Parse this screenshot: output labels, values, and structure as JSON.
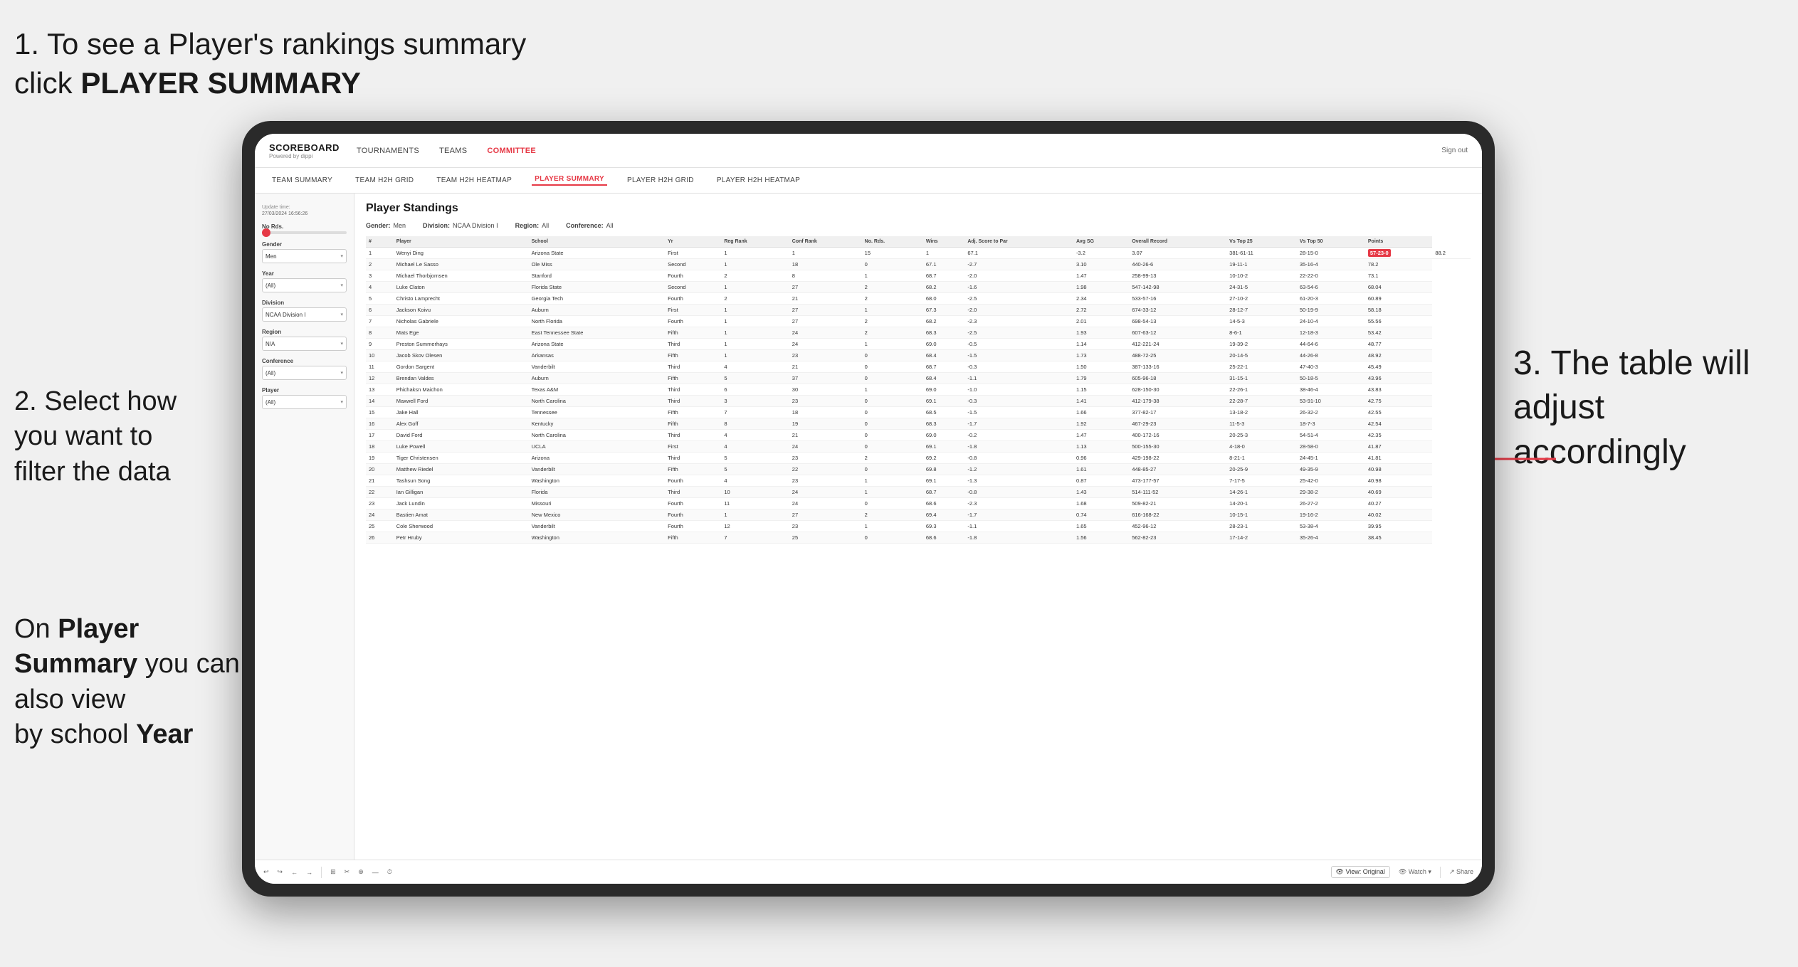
{
  "annotations": {
    "text1": "1. To see a Player's rankings summary click ",
    "text1_bold": "PLAYER SUMMARY",
    "text2_line1": "2. Select how",
    "text2_line2": "you want to",
    "text2_line3": "filter the data",
    "text3_line1": "3. The table will",
    "text3_line2": "adjust accordingly",
    "text4_line1": "On ",
    "text4_bold1": "Player",
    "text4_line2": "Summary",
    "text4_normal": " you can also view by school ",
    "text4_bold2": "Year"
  },
  "navbar": {
    "logo": "SCOREBOARD",
    "logo_sub": "Powered by dippi",
    "nav_items": [
      "TOURNAMENTS",
      "TEAMS",
      "COMMITTEE"
    ],
    "nav_right": [
      "Sign out"
    ],
    "subnav_items": [
      "TEAM SUMMARY",
      "TEAM H2H GRID",
      "TEAM H2H HEATMAP",
      "PLAYER SUMMARY",
      "PLAYER H2H GRID",
      "PLAYER H2H HEATMAP"
    ]
  },
  "sidebar": {
    "update_label": "Update time:",
    "update_time": "27/03/2024 16:56:26",
    "no_rds_label": "No Rds.",
    "slider_val": "0",
    "gender_label": "Gender",
    "gender_val": "Men",
    "year_label": "Year",
    "year_val": "(All)",
    "division_label": "Division",
    "division_val": "NCAA Division I",
    "region_label": "Region",
    "region_val": "N/A",
    "conference_label": "Conference",
    "conference_val": "(All)",
    "player_label": "Player",
    "player_val": "(All)"
  },
  "table": {
    "title": "Player Standings",
    "gender_label": "Gender:",
    "gender_val": "Men",
    "division_label": "Division:",
    "division_val": "NCAA Division I",
    "region_label": "Region:",
    "region_val": "All",
    "conference_label": "Conference:",
    "conference_val": "All",
    "columns": [
      "#",
      "Player",
      "School",
      "Yr",
      "Reg Rank",
      "Conf Rank",
      "No. Rds.",
      "Wins",
      "Adj. Score to Par",
      "Avg SG",
      "Overall Record",
      "Vs Top 25",
      "Vs Top 50",
      "Points"
    ],
    "rows": [
      [
        "1",
        "Wenyi Ding",
        "Arizona State",
        "First",
        "1",
        "1",
        "15",
        "1",
        "67.1",
        "-3.2",
        "3.07",
        "381-61-11",
        "28-15-0",
        "57-23-0",
        "88.2"
      ],
      [
        "2",
        "Michael Le Sasso",
        "Ole Miss",
        "Second",
        "1",
        "18",
        "0",
        "67.1",
        "-2.7",
        "3.10",
        "440-26-6",
        "19-11-1",
        "35-16-4",
        "78.2"
      ],
      [
        "3",
        "Michael Thorbjornsen",
        "Stanford",
        "Fourth",
        "2",
        "8",
        "1",
        "68.7",
        "-2.0",
        "1.47",
        "258-99-13",
        "10-10-2",
        "22-22-0",
        "73.1"
      ],
      [
        "4",
        "Luke Claton",
        "Florida State",
        "Second",
        "1",
        "27",
        "2",
        "68.2",
        "-1.6",
        "1.98",
        "547-142-98",
        "24-31-5",
        "63-54-6",
        "68.04"
      ],
      [
        "5",
        "Christo Lamprecht",
        "Georgia Tech",
        "Fourth",
        "2",
        "21",
        "2",
        "68.0",
        "-2.5",
        "2.34",
        "533-57-16",
        "27-10-2",
        "61-20-3",
        "60.89"
      ],
      [
        "6",
        "Jackson Koivu",
        "Auburn",
        "First",
        "1",
        "27",
        "1",
        "67.3",
        "-2.0",
        "2.72",
        "674-33-12",
        "28-12-7",
        "50-19-9",
        "58.18"
      ],
      [
        "7",
        "Nicholas Gabriele",
        "North Florida",
        "Fourth",
        "1",
        "27",
        "2",
        "68.2",
        "-2.3",
        "2.01",
        "698-54-13",
        "14-5-3",
        "24-10-4",
        "55.56"
      ],
      [
        "8",
        "Mats Ege",
        "East Tennessee State",
        "Fifth",
        "1",
        "24",
        "2",
        "68.3",
        "-2.5",
        "1.93",
        "607-63-12",
        "8-6-1",
        "12-18-3",
        "53.42"
      ],
      [
        "9",
        "Preston Summerhays",
        "Arizona State",
        "Third",
        "1",
        "24",
        "1",
        "69.0",
        "-0.5",
        "1.14",
        "412-221-24",
        "19-39-2",
        "44-64-6",
        "48.77"
      ],
      [
        "10",
        "Jacob Skov Olesen",
        "Arkansas",
        "Fifth",
        "1",
        "23",
        "0",
        "68.4",
        "-1.5",
        "1.73",
        "488-72-25",
        "20-14-5",
        "44-26-8",
        "48.92"
      ],
      [
        "11",
        "Gordon Sargent",
        "Vanderbilt",
        "Third",
        "4",
        "21",
        "0",
        "68.7",
        "-0.3",
        "1.50",
        "387-133-16",
        "25-22-1",
        "47-40-3",
        "45.49"
      ],
      [
        "12",
        "Brendan Valdes",
        "Auburn",
        "Fifth",
        "5",
        "37",
        "0",
        "68.4",
        "-1.1",
        "1.79",
        "605-96-18",
        "31-15-1",
        "50-18-5",
        "43.96"
      ],
      [
        "13",
        "Phichaksn Maichon",
        "Texas A&M",
        "Third",
        "6",
        "30",
        "1",
        "69.0",
        "-1.0",
        "1.15",
        "628-150-30",
        "22-26-1",
        "38-46-4",
        "43.83"
      ],
      [
        "14",
        "Maxwell Ford",
        "North Carolina",
        "Third",
        "3",
        "23",
        "0",
        "69.1",
        "-0.3",
        "1.41",
        "412-179-38",
        "22-28-7",
        "53-91-10",
        "42.75"
      ],
      [
        "15",
        "Jake Hall",
        "Tennessee",
        "Fifth",
        "7",
        "18",
        "0",
        "68.5",
        "-1.5",
        "1.66",
        "377-82-17",
        "13-18-2",
        "26-32-2",
        "42.55"
      ],
      [
        "16",
        "Alex Goff",
        "Kentucky",
        "Fifth",
        "8",
        "19",
        "0",
        "68.3",
        "-1.7",
        "1.92",
        "467-29-23",
        "11-5-3",
        "18-7-3",
        "42.54"
      ],
      [
        "17",
        "David Ford",
        "North Carolina",
        "Third",
        "4",
        "21",
        "0",
        "69.0",
        "-0.2",
        "1.47",
        "400-172-16",
        "20-25-3",
        "54-51-4",
        "42.35"
      ],
      [
        "18",
        "Luke Powell",
        "UCLA",
        "First",
        "4",
        "24",
        "0",
        "69.1",
        "-1.8",
        "1.13",
        "500-155-30",
        "4-18-0",
        "28-58-0",
        "41.87"
      ],
      [
        "19",
        "Tiger Christensen",
        "Arizona",
        "Third",
        "5",
        "23",
        "2",
        "69.2",
        "-0.8",
        "0.96",
        "429-198-22",
        "8-21-1",
        "24-45-1",
        "41.81"
      ],
      [
        "20",
        "Matthew Riedel",
        "Vanderbilt",
        "Fifth",
        "5",
        "22",
        "0",
        "69.8",
        "-1.2",
        "1.61",
        "448-85-27",
        "20-25-9",
        "49-35-9",
        "40.98"
      ],
      [
        "21",
        "Tashsun Song",
        "Washington",
        "Fourth",
        "4",
        "23",
        "1",
        "69.1",
        "-1.3",
        "0.87",
        "473-177-57",
        "7-17-5",
        "25-42-0",
        "40.98"
      ],
      [
        "22",
        "Ian Gilligan",
        "Florida",
        "Third",
        "10",
        "24",
        "1",
        "68.7",
        "-0.8",
        "1.43",
        "514-111-52",
        "14-26-1",
        "29-38-2",
        "40.69"
      ],
      [
        "23",
        "Jack Lundin",
        "Missouri",
        "Fourth",
        "11",
        "24",
        "0",
        "68.6",
        "-2.3",
        "1.68",
        "509-82-21",
        "14-20-1",
        "26-27-2",
        "40.27"
      ],
      [
        "24",
        "Bastien Amat",
        "New Mexico",
        "Fourth",
        "1",
        "27",
        "2",
        "69.4",
        "-1.7",
        "0.74",
        "616-168-22",
        "10-15-1",
        "19-16-2",
        "40.02"
      ],
      [
        "25",
        "Cole Sherwood",
        "Vanderbilt",
        "Fourth",
        "12",
        "23",
        "1",
        "69.3",
        "-1.1",
        "1.65",
        "452-96-12",
        "28-23-1",
        "53-38-4",
        "39.95"
      ],
      [
        "26",
        "Petr Hruby",
        "Washington",
        "Fifth",
        "7",
        "25",
        "0",
        "68.6",
        "-1.8",
        "1.56",
        "562-82-23",
        "17-14-2",
        "35-26-4",
        "38.45"
      ]
    ]
  },
  "toolbar": {
    "buttons": [
      "↩",
      "↪",
      "←",
      "→",
      "⊞",
      "✂",
      "⊕",
      "—",
      "⏱"
    ],
    "view_label": "View: Original",
    "watch_label": "Watch",
    "share_label": "Share"
  }
}
